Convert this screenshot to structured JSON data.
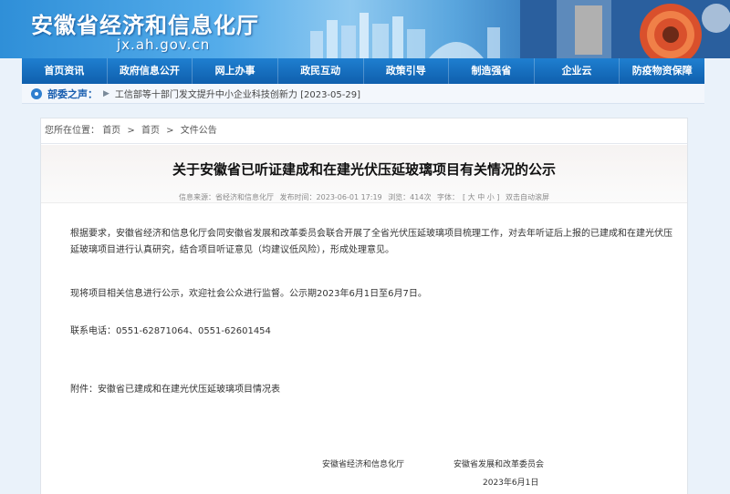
{
  "site": {
    "title": "安徽省经济和信息化厅",
    "domain": "jx.ah.gov.cn"
  },
  "nav": {
    "items": [
      "首页资讯",
      "政府信息公开",
      "网上办事",
      "政民互动",
      "政策引导",
      "制造强省",
      "企业云",
      "防疫物资保障"
    ]
  },
  "ticker": {
    "label": "部委之声：",
    "separator": "▶",
    "news": "工信部等十部门发文提升中小企业科技创新力 [2023-05-29]"
  },
  "breadcrumb": {
    "prefix": "您所在位置：",
    "items": [
      "首页",
      "首页",
      "文件公告"
    ],
    "separator": ">"
  },
  "article": {
    "title": "关于安徽省已听证建成和在建光伏压延玻璃项目有关情况的公示",
    "meta": {
      "source": "信息来源：省经济和信息化厅",
      "published": "发布时间：2023-06-01 17:19",
      "views": "浏览：414次",
      "font_label": "字体：",
      "font_sizes": "[ 大 中 小 ]",
      "autoscroll": "双击自动滚屏"
    },
    "paragraphs": [
      "根据要求，安徽省经济和信息化厅会同安徽省发展和改革委员会联合开展了全省光伏压延玻璃项目梳理工作，对去年听证后上报的已建成和在建光伏压延玻璃项目进行认真研究，结合项目听证意见（均建议低风险），形成处理意见。",
      "现将项目相关信息进行公示，欢迎社会公众进行监督。公示期2023年6月1日至6月7日。",
      "联系电话：0551-62871064、0551-62601454",
      "附件：安徽省已建成和在建光伏压延玻璃项目情况表"
    ],
    "signatures": [
      "安徽省经济和信息化厅",
      "安徽省发展和改革委员会"
    ],
    "date": "2023年6月1日"
  },
  "colors": {
    "nav_bg": "#0f5fad",
    "ticker_label": "#1a5fb0",
    "page_bg": "#eaf2fa"
  }
}
